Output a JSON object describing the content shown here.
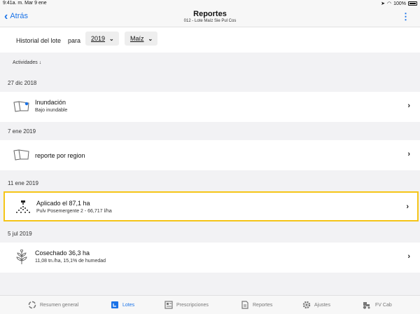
{
  "status": {
    "time_date": "9:41a. m.   Mar 9 ene",
    "battery": "100%"
  },
  "nav": {
    "back_label": "Atrás",
    "title": "Reportes",
    "subtitle": "012 - Lote Maíz Sie Pul Cos"
  },
  "filter": {
    "label": "Historial del lote",
    "para": "para",
    "year": "2019",
    "crop": "Maíz"
  },
  "sort": {
    "label": "Actividades ↓"
  },
  "sections": [
    {
      "date": "27 dic 2018",
      "items": [
        {
          "icon": "flood-field-icon",
          "title": "Inundación",
          "subtitle": "Bajo inundable"
        }
      ]
    },
    {
      "date": "7 ene 2019",
      "items": [
        {
          "icon": "field-report-icon",
          "title": "reporte por region",
          "subtitle": ""
        }
      ]
    },
    {
      "date": "11 ene 2019",
      "items": [
        {
          "icon": "sprayer-application-icon",
          "title": "Aplicado el 87,1 ha",
          "subtitle": "Pulv Posemergente 2 - 66,717 l/ha",
          "selected": true
        }
      ]
    },
    {
      "date": "5 jul 2019",
      "items": [
        {
          "icon": "harvest-wheat-icon",
          "title": "Cosechado 36,3 ha",
          "subtitle": "11,08 tn./ha, 15,1% de humedad"
        }
      ]
    }
  ],
  "tabs": [
    {
      "label": "Resumen general",
      "icon": "overview-icon"
    },
    {
      "label": "Lotes",
      "icon": "lotes-icon",
      "active": true
    },
    {
      "label": "Prescripciones",
      "icon": "prescriptions-icon"
    },
    {
      "label": "Reportes",
      "icon": "reports-icon"
    },
    {
      "label": "Ajustes",
      "icon": "settings-gear-icon"
    },
    {
      "label": "FV Cab",
      "icon": "tractor-icon"
    }
  ],
  "colors": {
    "accent": "#1a73e8",
    "highlight": "#f5c518"
  }
}
